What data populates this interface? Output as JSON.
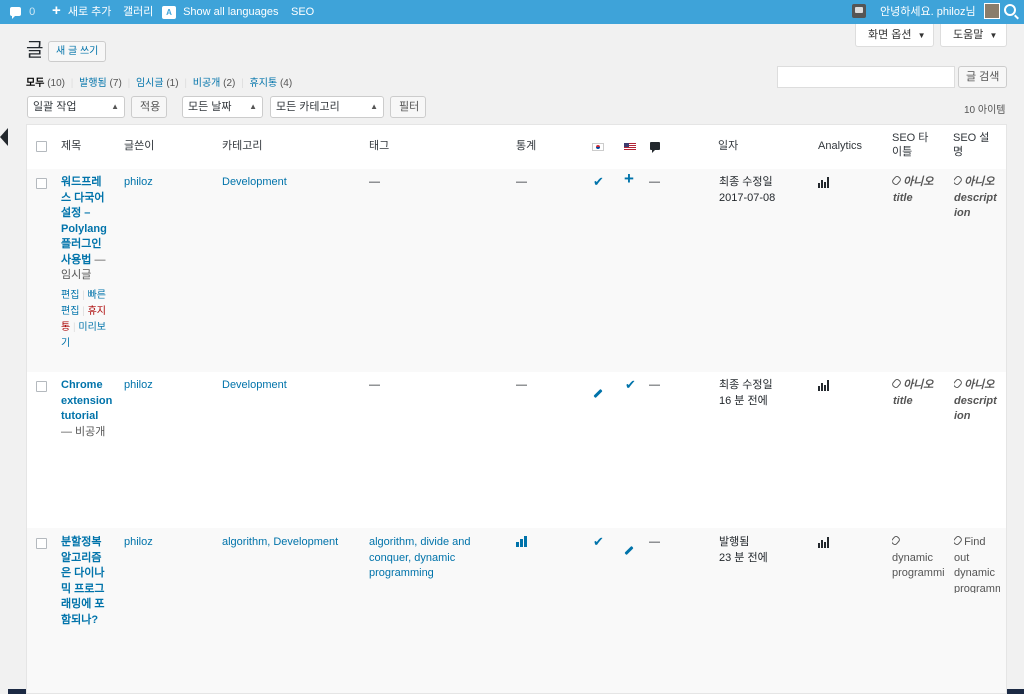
{
  "adminbar": {
    "comments_count": "0",
    "new_label": "새로 추가",
    "gallery_label": "갤러리",
    "languages_label": "Show all languages",
    "seo_label": "SEO",
    "greeting": "안녕하세요. philoz님"
  },
  "screen_options": "화면 옵션",
  "help": "도움말",
  "page_title": "글",
  "add_new": "새 글 쓰기",
  "filters": {
    "all": "모두",
    "all_count": "(10)",
    "published": "발행됨",
    "published_count": "(7)",
    "draft": "임시글",
    "draft_count": "(1)",
    "private": "비공개",
    "private_count": "(2)",
    "trash": "휴지통",
    "trash_count": "(4)",
    "sep": "|"
  },
  "search": {
    "value": "",
    "button": "글 검색"
  },
  "bulk": {
    "action": "일괄 작업",
    "apply": "적용",
    "dates": "모든 날짜",
    "categories": "모든 카테고리",
    "filter": "필터",
    "item_count": "10 아이템"
  },
  "columns": {
    "title": "제목",
    "author": "글쓴이",
    "categories": "카테고리",
    "tags": "태그",
    "stats": "통계",
    "date": "일자",
    "analytics": "Analytics",
    "seo_title": "SEO 타이틀",
    "seo_desc": "SEO 설명"
  },
  "rows": [
    {
      "title": "워드프레스 다국어 설정 – Polylang 플러그인 사용법",
      "state": "— 임시글",
      "actions": {
        "edit": "편집",
        "quick_edit": "빠른 편집",
        "trash": "휴지통",
        "preview": "미리보기"
      },
      "author": "philoz",
      "categories": "Development",
      "tags": "—",
      "stats": "—",
      "comments": "—",
      "date_status": "최종 수정일",
      "date_value": "2017-07-08",
      "seo_title_status": "아니오",
      "seo_title_text": "title",
      "seo_desc_status": "아니오",
      "seo_desc_text": "description"
    },
    {
      "title": "Chrome extension tutorial",
      "state": "— 비공개",
      "author": "philoz",
      "categories": "Development",
      "tags": "—",
      "stats": "—",
      "comments": "—",
      "date_status": "최종 수정일",
      "date_value": "16 분 전에",
      "seo_title_status": "아니오",
      "seo_title_text": "title",
      "seo_desc_status": "아니오",
      "seo_desc_text": "description"
    },
    {
      "title": "분할정복 알고리즘은 다이나믹 프로그래밍에 포함되나?",
      "author": "philoz",
      "categories": "algorithm, Development",
      "tags": "algorithm, divide and conquer, dynamic programming",
      "comments": "—",
      "date_status": "발행됨",
      "date_value": "23 분 전에",
      "seo_title_text": "dynamic programming",
      "seo_desc_text": "Find out dynamic programming"
    }
  ]
}
